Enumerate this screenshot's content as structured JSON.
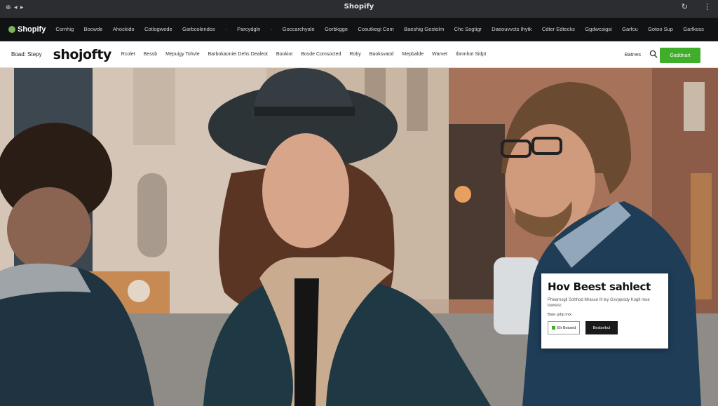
{
  "browser": {
    "title": "Shopify",
    "left_controls": "⊕ ◂ ▸",
    "right_icons": [
      "↻",
      "⋮"
    ]
  },
  "adminbar": {
    "brand": "Shopify",
    "nav": [
      "Comhig",
      "Bocwde",
      "Ahockido",
      "Cotlogwede",
      "Garbcolendos",
      "·",
      "Parcydgln",
      "·",
      "Goccarchyale",
      "Gorbkgge",
      "Cosutkegi Com",
      "Baeshig Gestolm",
      "Chc Sogtigr",
      "Daeouvvcts Ihytk",
      "Cdter Edtecks",
      "Ggdwcsigsi",
      "Garfcu",
      "Gotoo Sup",
      "Garlkoss"
    ]
  },
  "store": {
    "label": "Boad: Stepy",
    "logo": "shojofty",
    "menu": [
      "Rcolet",
      "Bessb",
      "Mepuigy Tohvle",
      "Barbokaoniei Dehs Dealeot",
      "Bookiot",
      "Bosde Comsocted",
      "Roby",
      "Baoksvaod",
      "Mepbalde",
      "Warvet",
      "Ibnmhot Sidpt"
    ],
    "account": "Batnes",
    "cta": "Gaddnart"
  },
  "card": {
    "title": "Hov Beest sahlect",
    "desc": "Phearnsgil Sohhod Mrasce Ill ley Gsvpjesdy Koglt mue lowresr.",
    "price": "Bate grbp mix",
    "btn_primary": "Elr Bossed",
    "btn_secondary": "Besborbul"
  },
  "colors": {
    "accent_green": "#3fae2a",
    "admin_bg": "#111214",
    "chrome_bg": "#2b2d31"
  }
}
